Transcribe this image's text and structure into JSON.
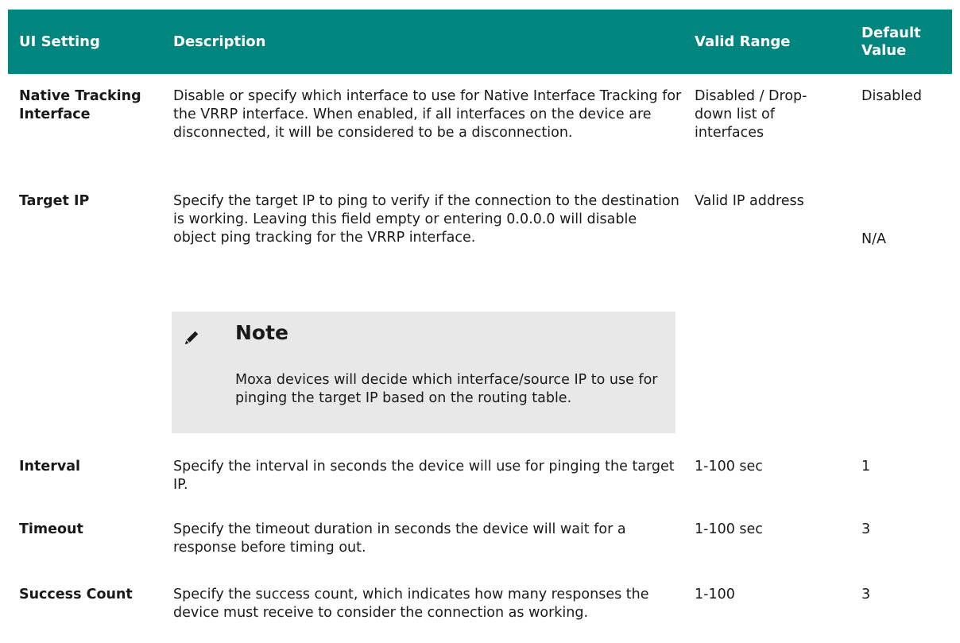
{
  "header": {
    "setting": "UI Setting",
    "description": "Description",
    "range": "Valid Range",
    "default": "Default Value"
  },
  "rows": [
    {
      "setting": "Native Tracking Interface",
      "description": "Disable or specify which interface to use for Native Interface Tracking for the VRRP interface. When enabled, if all interfaces on the device are disconnected, it will be considered to be a disconnection.",
      "range": "Disabled / Drop-down list of interfaces",
      "default": "Disabled"
    },
    {
      "setting": "Target IP",
      "description": "Specify the target IP to ping to verify if the connection to the destination is working. Leaving this field empty or entering 0.0.0.0 will disable object ping tracking for the VRRP interface.",
      "range": "Valid IP address",
      "default": "N/A"
    },
    {
      "setting": "Interval",
      "description": "Specify the interval in seconds the device will use for pinging the target IP.",
      "range": "1-100 sec",
      "default": "1"
    },
    {
      "setting": "Timeout",
      "description": "Specify the timeout duration in seconds the device will wait for a response before timing out.",
      "range": "1-100 sec",
      "default": "3"
    },
    {
      "setting": "Success Count",
      "description": "Specify the success count, which indicates how many responses the device must receive to consider the connection as working.",
      "range": "1-100",
      "default": "3"
    }
  ],
  "note": {
    "icon": "pencil-icon",
    "title": "Note",
    "text": "Moxa devices will decide which interface/source IP to use for pinging the target IP based on the routing table."
  },
  "colors": {
    "header_bg": "#00857f",
    "header_text": "#ffffff",
    "note_bg": "#e8e8e8"
  }
}
